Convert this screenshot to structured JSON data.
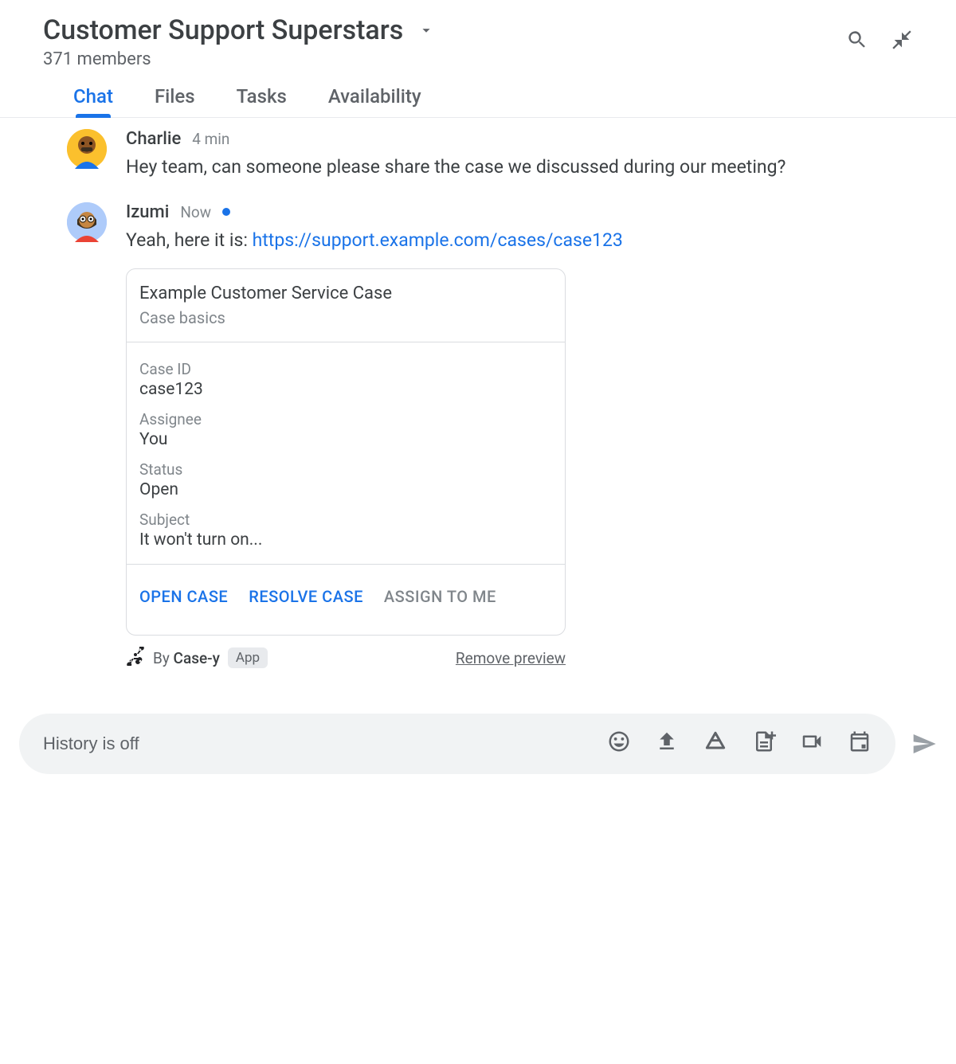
{
  "header": {
    "title": "Customer Support Superstars",
    "members_text": "371 members"
  },
  "tabs": [
    {
      "label": "Chat",
      "active": true
    },
    {
      "label": "Files",
      "active": false
    },
    {
      "label": "Tasks",
      "active": false
    },
    {
      "label": "Availability",
      "active": false
    }
  ],
  "messages": [
    {
      "author": "Charlie",
      "time": "4 min",
      "online": false,
      "text": "Hey team, can someone please share the case we discussed during our meeting?"
    },
    {
      "author": "Izumi",
      "time": "Now",
      "online": true,
      "text_prefix": "Yeah, here it is: ",
      "link_text": "https://support.example.com/cases/case123"
    }
  ],
  "card": {
    "title": "Example Customer Service Case",
    "subtitle": "Case basics",
    "fields": [
      {
        "label": "Case ID",
        "value": "case123"
      },
      {
        "label": "Assignee",
        "value": "You"
      },
      {
        "label": "Status",
        "value": "Open"
      },
      {
        "label": "Subject",
        "value": "It won't turn on..."
      }
    ],
    "actions": [
      {
        "label": "OPEN CASE",
        "style": "primary"
      },
      {
        "label": "RESOLVE CASE",
        "style": "primary"
      },
      {
        "label": "ASSIGN TO ME",
        "style": "muted"
      }
    ],
    "meta_by": "By ",
    "meta_app_name": "Case-y",
    "meta_badge": "App",
    "remove_label": "Remove preview"
  },
  "composer": {
    "placeholder": "History is off"
  }
}
